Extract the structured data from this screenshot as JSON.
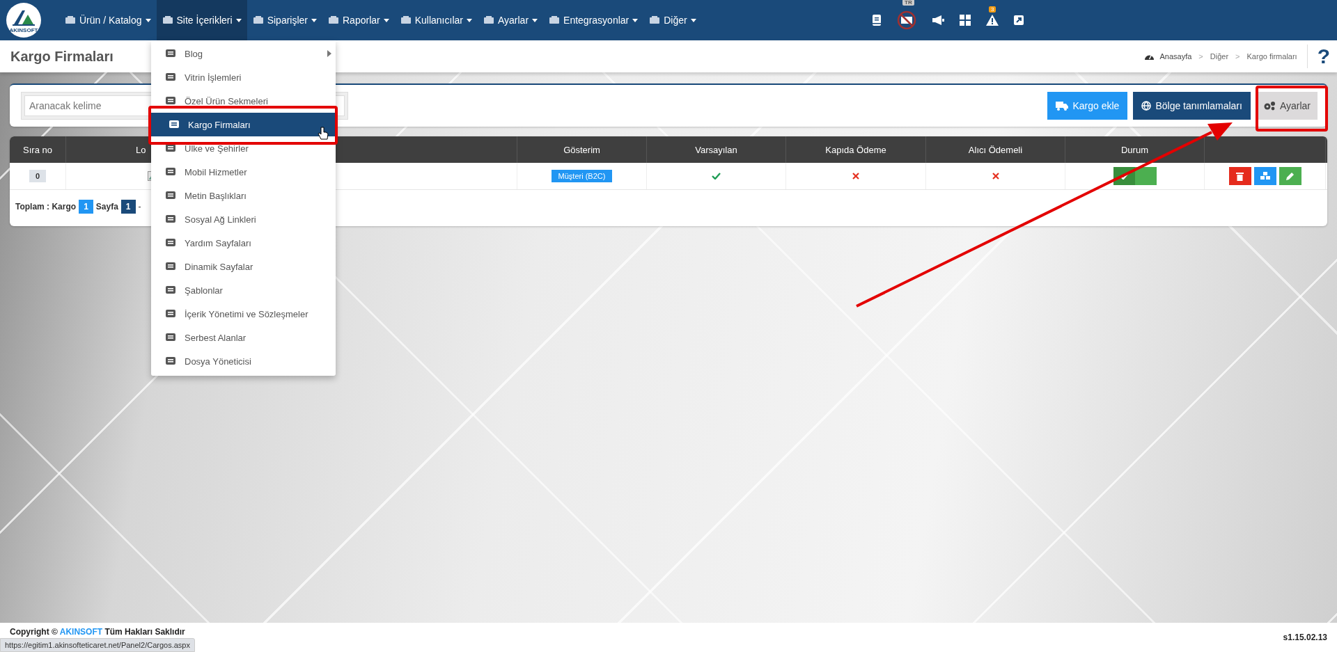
{
  "navbar": {
    "logo_text": "AKINSOFT",
    "menu": [
      {
        "label": "Ürün / Katalog",
        "selected": false
      },
      {
        "label": "Site İçerikleri",
        "selected": true
      },
      {
        "label": "Siparişler",
        "selected": false
      },
      {
        "label": "Raporlar",
        "selected": false
      },
      {
        "label": "Kullanıcılar",
        "selected": false
      },
      {
        "label": "Ayarlar",
        "selected": false
      },
      {
        "label": "Entegrasyonlar",
        "selected": false
      },
      {
        "label": "Diğer",
        "selected": false
      }
    ],
    "language_badge": "TR",
    "alert_count": "3"
  },
  "page_title": "Kargo Firmaları",
  "breadcrumb": [
    {
      "label": "Anasayfa"
    },
    {
      "separator": ">",
      "label": "Diğer"
    },
    {
      "separator": ">",
      "label": "Kargo firmaları"
    }
  ],
  "help": "?",
  "toolbar": {
    "search": {
      "placeholder": "Aranacak kelime"
    },
    "buttons": [
      {
        "kind": "add",
        "label": "Kargo ekle"
      },
      {
        "kind": "regions",
        "label": "Bölge tanımlamaları"
      },
      {
        "kind": "settings",
        "label": "Ayarlar"
      }
    ]
  },
  "table": {
    "columns": [
      "Sıra no",
      "Lo",
      "",
      "Gösterim",
      "Varsayılan",
      "Kapıda Ödeme",
      "Alıcı Ödemeli",
      "Durum",
      ""
    ],
    "rows": [
      {
        "order": "0",
        "display": "Müşteri (B2C)",
        "default": true,
        "cash_on_delivery": false,
        "receiver_pays": false,
        "active": true
      }
    ]
  },
  "pager": {
    "total_label": "Toplam : Kargo",
    "total": "1",
    "page_label": "Sayfa",
    "page": "1",
    "separator": "-"
  },
  "dropdown": [
    {
      "label": "Blog",
      "submenu": true,
      "selected": false
    },
    {
      "label": "Vitrin İşlemleri",
      "submenu": false,
      "selected": false
    },
    {
      "label": "Özel Ürün Sekmeleri",
      "submenu": false,
      "selected": false
    },
    {
      "label": "Kargo Firmaları",
      "submenu": false,
      "selected": true
    },
    {
      "label": "Ülke ve Şehirler",
      "submenu": false,
      "selected": false
    },
    {
      "label": "Mobil Hizmetler",
      "submenu": false,
      "selected": false
    },
    {
      "label": "Metin Başlıkları",
      "submenu": false,
      "selected": false
    },
    {
      "label": "Sosyal Ağ Linkleri",
      "submenu": false,
      "selected": false
    },
    {
      "label": "Yardım Sayfaları",
      "submenu": false,
      "selected": false
    },
    {
      "label": "Dinamik Sayfalar",
      "submenu": false,
      "selected": false
    },
    {
      "label": "Şablonlar",
      "submenu": false,
      "selected": false
    },
    {
      "label": "İçerik Yönetimi ve Sözleşmeler",
      "submenu": false,
      "selected": false
    },
    {
      "label": "Serbest Alanlar",
      "submenu": false,
      "selected": false
    },
    {
      "label": "Dosya Yöneticisi",
      "submenu": false,
      "selected": false
    }
  ],
  "footer": {
    "copyright": "Copyright ©",
    "link": "AKINSOFT",
    "rights": "Tüm Hakları Saklıdır",
    "version": "s1.15.02.13"
  },
  "status_url": "https://egitim1.akinsofteticaret.net/Panel2/Cargos.aspx"
}
